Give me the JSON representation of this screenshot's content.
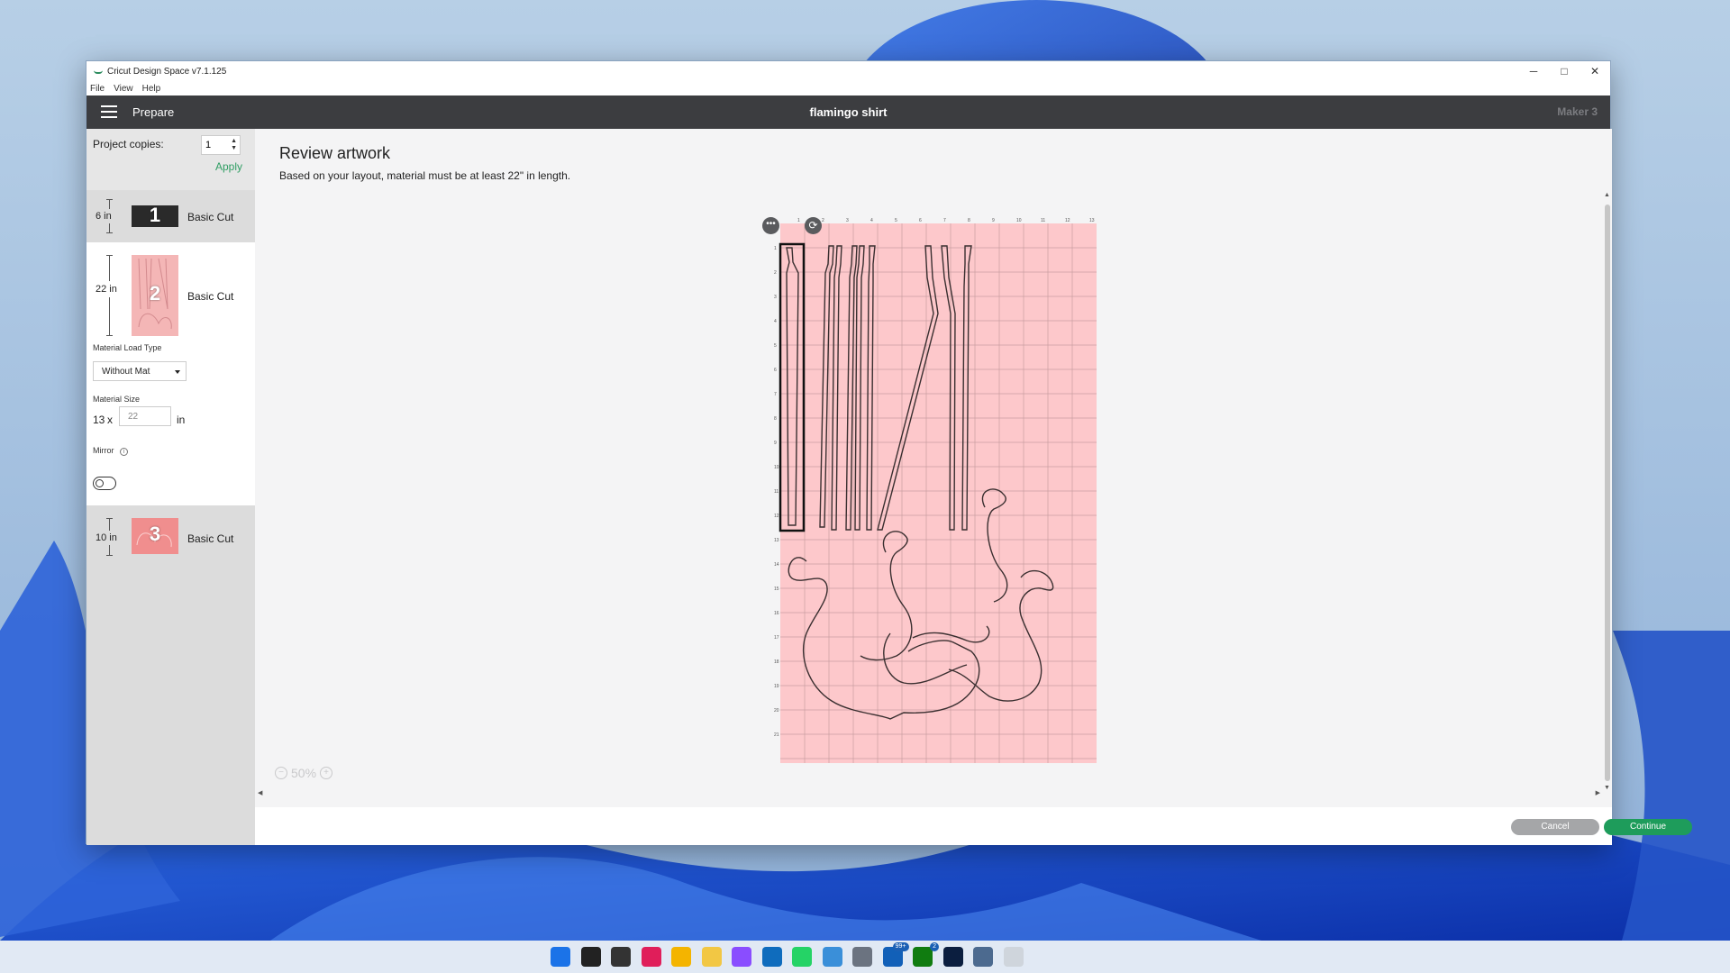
{
  "window": {
    "title": "Cricut Design Space  v7.1.125",
    "menu": [
      "File",
      "View",
      "Help"
    ],
    "controls": {
      "minimize": "─",
      "maximize": "□",
      "close": "✕"
    }
  },
  "header": {
    "section": "Prepare",
    "project": "flamingo shirt",
    "machine": "Maker 3"
  },
  "sidebar": {
    "copies_label": "Project copies:",
    "copies_value": "1",
    "apply_label": "Apply",
    "mats": [
      {
        "size": "6 in",
        "number": "1",
        "mode": "Basic Cut",
        "color": "#2a2a2a"
      },
      {
        "size": "22 in",
        "number": "2",
        "mode": "Basic Cut",
        "color": "#f4b6b6"
      },
      {
        "size": "10 in",
        "number": "3",
        "mode": "Basic Cut",
        "color": "#f08e8e"
      }
    ],
    "load_type_label": "Material Load Type",
    "load_type_value": "Without Mat",
    "material_size_label": "Material Size",
    "material_width": "13",
    "material_x": "x",
    "material_length_placeholder": "22",
    "material_unit": "in",
    "mirror_label": "Mirror",
    "mirror_on": false
  },
  "main": {
    "title": "Review artwork",
    "subtitle": "Based on your layout, material must be at least 22\" in length.",
    "mat_color": "#fdc8cb",
    "mat_top_ruler": [
      "1",
      "2",
      "3",
      "4",
      "5",
      "6",
      "7",
      "8",
      "9",
      "10",
      "11",
      "12",
      "13"
    ],
    "mat_left_ruler": [
      "1",
      "2",
      "3",
      "4",
      "5",
      "6",
      "7",
      "8",
      "9",
      "10",
      "11",
      "12",
      "13",
      "14",
      "15",
      "16",
      "17",
      "18",
      "19",
      "20",
      "21"
    ],
    "zoom_label": "50%",
    "more_icon": "more-horizontal-icon",
    "rotate_icon": "rotate-icon"
  },
  "footer": {
    "cancel_label": "Cancel",
    "continue_label": "Continue",
    "accent": "#1e9c5b"
  },
  "taskbar": {
    "apps": [
      "windows-start-icon",
      "search-icon",
      "task-view-icon",
      "slack-icon",
      "chrome-icon",
      "file-explorer-icon",
      "messenger-icon",
      "outlook-icon",
      "whatsapp-icon",
      "vpn-icon",
      "settings-icon",
      "mail-icon",
      "xbox-icon",
      "photoshop-icon",
      "notepad-icon",
      "cricut-icon"
    ],
    "badges": {
      "mail-icon": "99+",
      "xbox-icon": "2"
    }
  }
}
